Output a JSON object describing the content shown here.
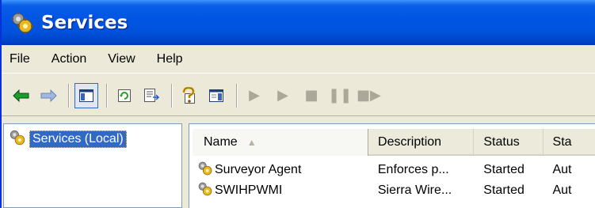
{
  "window": {
    "title": "Services",
    "title_icon": "services-gears-icon"
  },
  "menubar": {
    "items": [
      "File",
      "Action",
      "View",
      "Help"
    ]
  },
  "toolbar": {
    "buttons": [
      {
        "icon": "back-arrow-icon",
        "enabled": true
      },
      {
        "icon": "forward-arrow-icon",
        "enabled": true
      },
      {
        "icon": "show-hide-console-tree-icon",
        "enabled": true,
        "pressed": true
      },
      {
        "icon": "refresh-icon",
        "enabled": true
      },
      {
        "icon": "export-list-icon",
        "enabled": true
      },
      {
        "icon": "help-icon",
        "enabled": true
      },
      {
        "icon": "properties-pane-icon",
        "enabled": true
      },
      {
        "icon": "start-service-icon",
        "enabled": false
      },
      {
        "icon": "start-service-alt-icon",
        "enabled": false
      },
      {
        "icon": "stop-service-icon",
        "enabled": false
      },
      {
        "icon": "pause-service-icon",
        "enabled": false
      },
      {
        "icon": "restart-service-icon",
        "enabled": false
      }
    ]
  },
  "tree": {
    "root_label": "Services (Local)",
    "root_icon": "services-gears-icon"
  },
  "list": {
    "columns": [
      "Name",
      "Description",
      "Status",
      "Sta"
    ],
    "sort_indicator": "ascending",
    "rows": [
      {
        "name": "Surveyor Agent",
        "description": "Enforces p...",
        "status": "Started",
        "startup": "Aut"
      },
      {
        "name": "SWIHPWMI",
        "description": "Sierra Wire...",
        "status": "Started",
        "startup": "Aut"
      }
    ]
  },
  "colors": {
    "titlebar_blue": "#0055e5",
    "selection_blue": "#316ac5",
    "face": "#ECE9D8"
  }
}
